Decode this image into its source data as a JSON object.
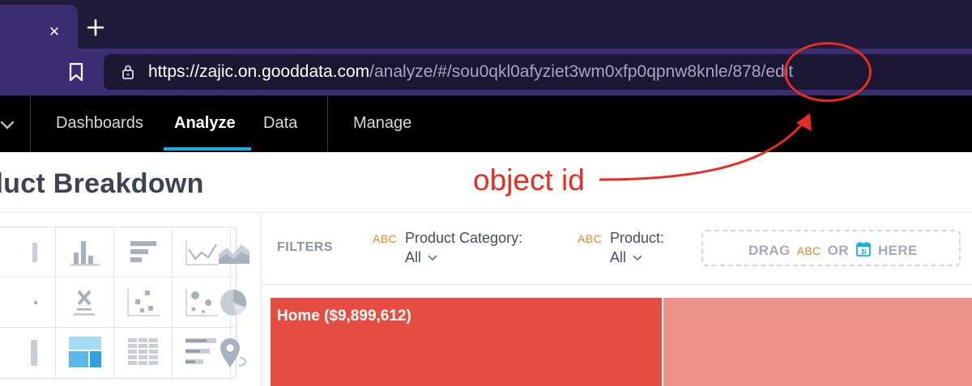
{
  "browser": {
    "url_host": "https://zajic.on.gooddata.com",
    "url_path": "/analyze/#/sou0qkl0afyziet3wm0xfp0qpnw8knle/878/edit",
    "tab_close_glyph": "×"
  },
  "nav": {
    "items": [
      "Dashboards",
      "Analyze",
      "Data"
    ],
    "active": "Analyze",
    "manage": "Manage"
  },
  "page": {
    "title": "oduct Breakdown"
  },
  "filters": {
    "label": "FILTERS",
    "items": [
      {
        "type": "ABC",
        "name": "Product Category:",
        "value": "All"
      },
      {
        "type": "ABC",
        "name": "Product:",
        "value": "All"
      }
    ],
    "drop_zone": {
      "drag": "DRAG",
      "abc": "ABC",
      "or": "OR",
      "here": "HERE"
    }
  },
  "treemap": {
    "home_label": "Home ($9,899,612)"
  },
  "annotation": {
    "label": "object id"
  },
  "colors": {
    "tab_strip": "#1f1b3a",
    "toolbar": "#3b2d72",
    "accent_underline": "#14b2e2",
    "treemap_primary": "#e54d42",
    "treemap_secondary": "#ee928b",
    "annotation": "#ea2b1f",
    "attribute_orange": "#e5862d"
  },
  "icons": {
    "vis_types": [
      "column-chart-icon",
      "bar-chart-icon",
      "line-chart-icon",
      "area-chart-icon",
      "headline-icon",
      "scatter-plot-icon",
      "bubble-chart-icon",
      "pie-chart-icon",
      "treemap-icon",
      "heatmap-icon",
      "bullet-chart-icon",
      "geo-chart-icon"
    ]
  }
}
